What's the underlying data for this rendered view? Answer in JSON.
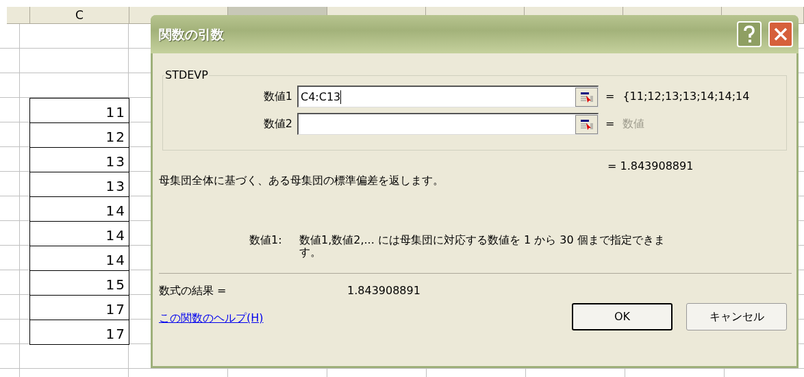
{
  "spreadsheet": {
    "columns": [
      {
        "selected": false
      },
      {
        "label": "C",
        "selected": false
      },
      {
        "selected": false
      },
      {
        "selected": true
      },
      {
        "selected": false
      },
      {
        "selected": false
      },
      {
        "selected": false
      },
      {
        "selected": false
      },
      {
        "selected": false
      }
    ],
    "column_c_cells": [
      "",
      "",
      "",
      "11",
      "12",
      "13",
      "13",
      "14",
      "14",
      "14",
      "15",
      "17",
      "17",
      ""
    ]
  },
  "dialog": {
    "title": "関数の引数",
    "function_name": "STDEVP",
    "arguments": [
      {
        "label": "数値1",
        "value": "C4:C13",
        "focused": true,
        "equals": "=",
        "result": "{11;12;13;13;14;14;14",
        "result_dimmed": false
      },
      {
        "label": "数値2",
        "focused": false,
        "equals": "=",
        "result": "数値",
        "result_dimmed": true
      }
    ],
    "formula_preview": "= 1.843908891",
    "description": "母集団全体に基づく、ある母集団の標準偏差を返します。",
    "argument_help": {
      "label": "数値1:",
      "text": "数値1,数値2,... には母集団に対応する数値を 1 から 30 個まで指定できます。"
    },
    "formula_result_label": "数式の結果 =",
    "formula_result_value": "1.843908891",
    "help_link": "この関数のヘルプ(H)",
    "buttons": [
      {
        "label": "OK",
        "default": true
      },
      {
        "label": "キャンセル",
        "default": false
      }
    ]
  }
}
